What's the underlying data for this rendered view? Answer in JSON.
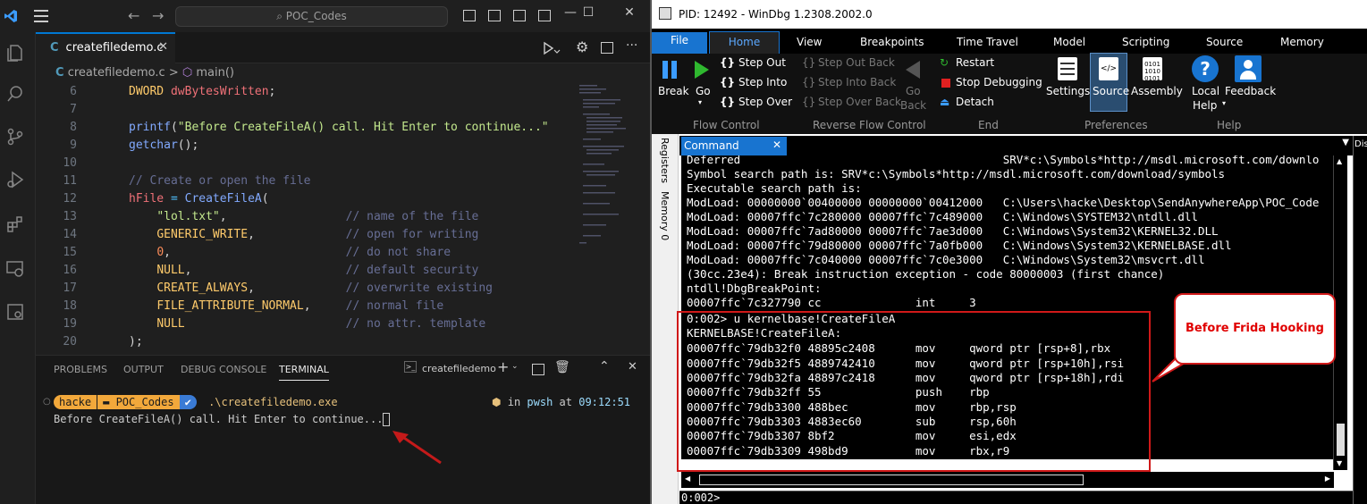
{
  "vscode": {
    "search_placeholder": "POC_Codes",
    "tab_label": "createfiledemo.c",
    "breadcrumb_file": "createfiledemo.c",
    "breadcrumb_sep": ">",
    "breadcrumb_symbol": "main()",
    "line_numbers": [
      "6",
      "7",
      "8",
      "9",
      "10",
      "11",
      "12",
      "13",
      "14",
      "15",
      "16",
      "17",
      "18",
      "19",
      "20"
    ],
    "panel_tabs": [
      "PROBLEMS",
      "OUTPUT",
      "DEBUG CONSOLE",
      "TERMINAL"
    ],
    "terminal_name": "createfiledemo",
    "prompt_user": "hacke",
    "prompt_dir": "POC_Codes",
    "prompt_cmd": ".\\createfiledemo.exe",
    "prompt_shell": "pwsh",
    "prompt_in": "in",
    "prompt_at": "at",
    "prompt_time": "09:12:51",
    "output_line": "Before CreateFileA() call. Hit Enter to continue..."
  },
  "windbg": {
    "title": "PID: 12492 - WinDbg 1.2308.2002.0",
    "tabs": [
      "File",
      "Home",
      "View",
      "Breakpoints",
      "Time Travel",
      "Model",
      "Scripting",
      "Source",
      "Memory"
    ],
    "ribbon": {
      "break": "Break",
      "go": "Go",
      "step_out": "Step Out",
      "step_into": "Step Into",
      "step_over": "Step Over",
      "step_out_back": "Step Out Back",
      "step_into_back": "Step Into Back",
      "step_over_back": "Step Over Back",
      "go_back_1": "Go",
      "go_back_2": "Back",
      "restart": "Restart",
      "stop_debugging": "Stop Debugging",
      "detach": "Detach",
      "settings": "Settings",
      "source": "Source",
      "assembly": "Assembly",
      "local_help_1": "Local",
      "local_help_2": "Help",
      "feedback": "Feedback",
      "groups": [
        "Flow Control",
        "Reverse Flow Control",
        "End",
        "Preferences",
        "Help"
      ]
    },
    "side_tabs": [
      "Registers",
      "Memory 0"
    ],
    "command_tab": "Command",
    "output_lines": [
      "Deferred                                       SRV*c:\\Symbols*http://msdl.microsoft.com/downlo",
      "Symbol search path is: SRV*c:\\Symbols*http://msdl.microsoft.com/download/symbols",
      "Executable search path is:",
      "ModLoad: 00000000`00400000 00000000`00412000   C:\\Users\\hacke\\Desktop\\SendAnywhereApp\\POC_Code",
      "ModLoad: 00007ffc`7c280000 00007ffc`7c489000   C:\\Windows\\SYSTEM32\\ntdll.dll",
      "ModLoad: 00007ffc`7ad80000 00007ffc`7ae3d000   C:\\Windows\\System32\\KERNEL32.DLL",
      "ModLoad: 00007ffc`79d80000 00007ffc`7a0fb000   C:\\Windows\\System32\\KERNELBASE.dll",
      "ModLoad: 00007ffc`7c040000 00007ffc`7c0e3000   C:\\Windows\\System32\\msvcrt.dll",
      "(30cc.23e4): Break instruction exception - code 80000003 (first chance)",
      "ntdll!DbgBreakPoint:",
      "00007ffc`7c327790 cc              int     3",
      "0:002> u kernelbase!CreateFileA",
      "KERNELBASE!CreateFileA:",
      "00007ffc`79db32f0 48895c2408      mov     qword ptr [rsp+8],rbx",
      "00007ffc`79db32f5 4889742410      mov     qword ptr [rsp+10h],rsi",
      "00007ffc`79db32fa 48897c2418      mov     qword ptr [rsp+18h],rdi",
      "00007ffc`79db32ff 55              push    rbp",
      "00007ffc`79db3300 488bec          mov     rbp,rsp",
      "00007ffc`79db3303 4883ec60        sub     rsp,60h",
      "00007ffc`79db3307 8bf2            mov     esi,edx",
      "00007ffc`79db3309 498bd9          mov     rbx,r9"
    ],
    "command_prompt": "0:002>",
    "right_pane_label": "Dis",
    "callout": "Before Frida Hooking"
  }
}
